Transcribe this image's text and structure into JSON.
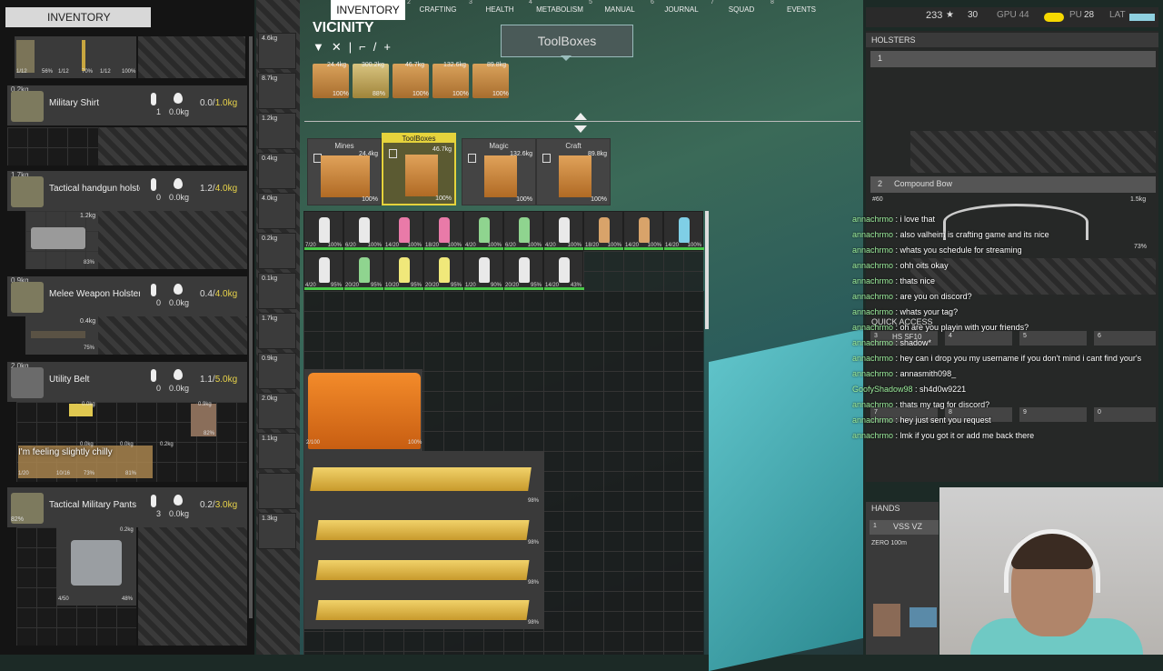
{
  "inventory_title": "INVENTORY",
  "tabs": [
    {
      "key": "",
      "label": "INVENTORY"
    },
    {
      "key": "2",
      "label": "CRAFTING"
    },
    {
      "key": "3",
      "label": "HEALTH"
    },
    {
      "key": "4",
      "label": "METABOLISM"
    },
    {
      "key": "5",
      "label": "MANUAL"
    },
    {
      "key": "6",
      "label": "JOURNAL"
    },
    {
      "key": "7",
      "label": "SQUAD"
    },
    {
      "key": "8",
      "label": "EVENTS"
    }
  ],
  "top_row_items": [
    {
      "label": "1/12",
      "pct": ""
    },
    {
      "label": "56%",
      "pct": ""
    },
    {
      "label": "1/12",
      "pct": ""
    },
    {
      "label": "70%",
      "pct": ""
    },
    {
      "label": "1/12",
      "pct": ""
    },
    {
      "label": "100%",
      "pct": ""
    }
  ],
  "clothing": [
    {
      "weight": "0.2kg",
      "name": "Military Shirt",
      "n1": "1",
      "n2": "0.0kg",
      "cap_used": "0.0/",
      "cap_max": "1.0kg",
      "pct": ""
    },
    {
      "weight": "1.7kg",
      "name": "Tactical handgun holster",
      "n1": "0",
      "n2": "0.0kg",
      "cap_used": "1.2/",
      "cap_max": "4.0kg",
      "pct": "85%"
    },
    {
      "weight": "0.9kg",
      "name": "Melee Weapon Holster",
      "n1": "0",
      "n2": "0.0kg",
      "cap_used": "0.4/",
      "cap_max": "4.0kg",
      "pct": "85%"
    },
    {
      "weight": "2.0kg",
      "name": "Utility Belt",
      "n1": "0",
      "n2": "0.0kg",
      "cap_used": "1.1/",
      "cap_max": "5.0kg",
      "pct": "85%"
    },
    {
      "weight": "1.1kg",
      "name": "Tactical Military Pants",
      "n1": "3",
      "n2": "0.0kg",
      "cap_used": "0.2/",
      "cap_max": "3.0kg",
      "pct": "82%"
    }
  ],
  "holster_items": {
    "pistol_weight": "1.2kg",
    "pistol_pct": "83%",
    "knife_weight": "0.4kg",
    "knife_pct": "75%",
    "belt_item1_weight": "0.0kg",
    "belt_item2_weight": "0.9kg",
    "belt_item2_pct": "82%",
    "belt_small_weights": [
      "0.0kg",
      "0.0kg",
      "0.2kg"
    ],
    "belt_small_labels": [
      "1/20",
      "10/16",
      "73%",
      "81%"
    ],
    "pants_item_weight": "0.2kg",
    "pants_item_count": "4/50",
    "pants_item_pct": "48%"
  },
  "status_message": "I'm feeling slightly chilly",
  "equipment_weights": [
    "4.6kg",
    "8.7kg",
    "1.2kg",
    "0.4kg",
    "4.0kg",
    "0.2kg",
    "0.1kg",
    "1.7kg",
    "0.9kg",
    "2.0kg",
    "1.1kg",
    "",
    "1.3kg"
  ],
  "equipment_pcts": [
    "",
    "",
    "83%",
    "",
    "51%",
    "85%",
    "",
    "",
    "85%",
    "85%",
    "82%",
    "95%",
    "85%"
  ],
  "vicinity": {
    "title": "VICINITY",
    "tooltip": "ToolBoxes",
    "ground_items": [
      {
        "weight": "24.4kg",
        "pct": "100%"
      },
      {
        "weight": "300.2kg",
        "pct": "88%"
      },
      {
        "weight": "46.7kg",
        "pct": "100%"
      },
      {
        "weight": "132.6kg",
        "pct": "100%"
      },
      {
        "weight": "89.8kg",
        "pct": "100%"
      }
    ],
    "containers": [
      {
        "label": "Mines",
        "weight": "24.4kg",
        "pct": "100%"
      },
      {
        "label": "ToolBoxes",
        "weight": "46.7kg",
        "pct": "100%"
      },
      {
        "label": "Magic",
        "weight": "132.6kg",
        "pct": "100%"
      },
      {
        "label": "Craft",
        "weight": "89.8kg",
        "pct": "100%"
      }
    ],
    "bottles_row1": [
      {
        "count": "7/20",
        "pct": "100%",
        "color": "#e9e9e9"
      },
      {
        "count": "6/20",
        "pct": "100%",
        "color": "#e9e9e9"
      },
      {
        "count": "14/20",
        "pct": "100%",
        "color": "#e97aa8"
      },
      {
        "count": "18/20",
        "pct": "100%",
        "color": "#e97aa8"
      },
      {
        "count": "4/20",
        "pct": "100%",
        "color": "#8fd48f"
      },
      {
        "count": "6/20",
        "pct": "100%",
        "color": "#8fd48f"
      },
      {
        "count": "4/20",
        "pct": "100%",
        "color": "#e9e9e9"
      },
      {
        "count": "18/20",
        "pct": "100%",
        "color": "#d8a36a"
      },
      {
        "count": "14/20",
        "pct": "100%",
        "color": "#d8a36a"
      },
      {
        "count": "14/20",
        "pct": "100%",
        "color": "#7fcfe6"
      }
    ],
    "bottles_row2": [
      {
        "count": "4/20",
        "pct": "95%",
        "color": "#e9e9e9"
      },
      {
        "count": "20/20",
        "pct": "95%",
        "color": "#8fd48f"
      },
      {
        "count": "10/20",
        "pct": "95%",
        "color": "#f0e87a"
      },
      {
        "count": "20/20",
        "pct": "95%",
        "color": "#f0e87a"
      },
      {
        "count": "1/20",
        "pct": "90%",
        "color": "#e9e9e9"
      },
      {
        "count": "20/20",
        "pct": "95%",
        "color": "#e9e9e9"
      },
      {
        "count": "14/20",
        "pct": "43%",
        "color": "#e9e9e9"
      }
    ],
    "toolbox_count": "2/100",
    "toolbox_pct": "100%",
    "plank_pcts": [
      "98%",
      "98%",
      "98%",
      "98%"
    ]
  },
  "hud": {
    "players": "233",
    "ping": "30",
    "gpu_label": "GPU 44",
    "cpu_label": "PU",
    "cpu_val": "28",
    "lat": "LAT"
  },
  "holsters": {
    "header": "HOLSTERS",
    "slot1_key": "1",
    "slot2_key": "2",
    "slot2_name": "Compound Bow",
    "bow_ammo": "#60",
    "bow_weight": "1.5kg",
    "bow_pct": "73%"
  },
  "quick_access": {
    "header": "QUICK ACCESS",
    "slot3": "HS SF10",
    "keys": [
      "3",
      "4",
      "5",
      "6",
      "7",
      "8",
      "9",
      "0"
    ]
  },
  "hands": {
    "header": "HANDS",
    "key": "1",
    "weapon": "VSS VZ",
    "zero": "ZERO 100m"
  },
  "chat": [
    {
      "user": "annachrmo",
      "msg": "i love that"
    },
    {
      "user": "annachrmo",
      "msg": "also valheim is crafting game and its nice"
    },
    {
      "user": "annachrmo",
      "msg": "whats you schedule for streaming"
    },
    {
      "user": "annachrmo",
      "msg": "ohh oits okay"
    },
    {
      "user": "annachrmo",
      "msg": "thats nice"
    },
    {
      "user": "annachrmo",
      "msg": "are you on discord?"
    },
    {
      "user": "annachrmo",
      "msg": "whats your tag?"
    },
    {
      "user": "annachrmo",
      "msg": "oh are you playin with your friends?"
    },
    {
      "user": "annachrmo",
      "msg": "shadow*"
    },
    {
      "user": "annachrmo",
      "msg": "hey can i drop you my username if you don't mind i cant find your's"
    },
    {
      "user": "annachrmo",
      "msg": "annasmith098_"
    },
    {
      "user": "GoofyShadow98",
      "msg": "sh4d0w9221"
    },
    {
      "user": "annachrmo",
      "msg": "thats my tag for discord?"
    },
    {
      "user": "annachrmo",
      "msg": "hey just sent you request"
    },
    {
      "user": "annachrmo",
      "msg": "lmk if you got it or add me back there"
    }
  ]
}
